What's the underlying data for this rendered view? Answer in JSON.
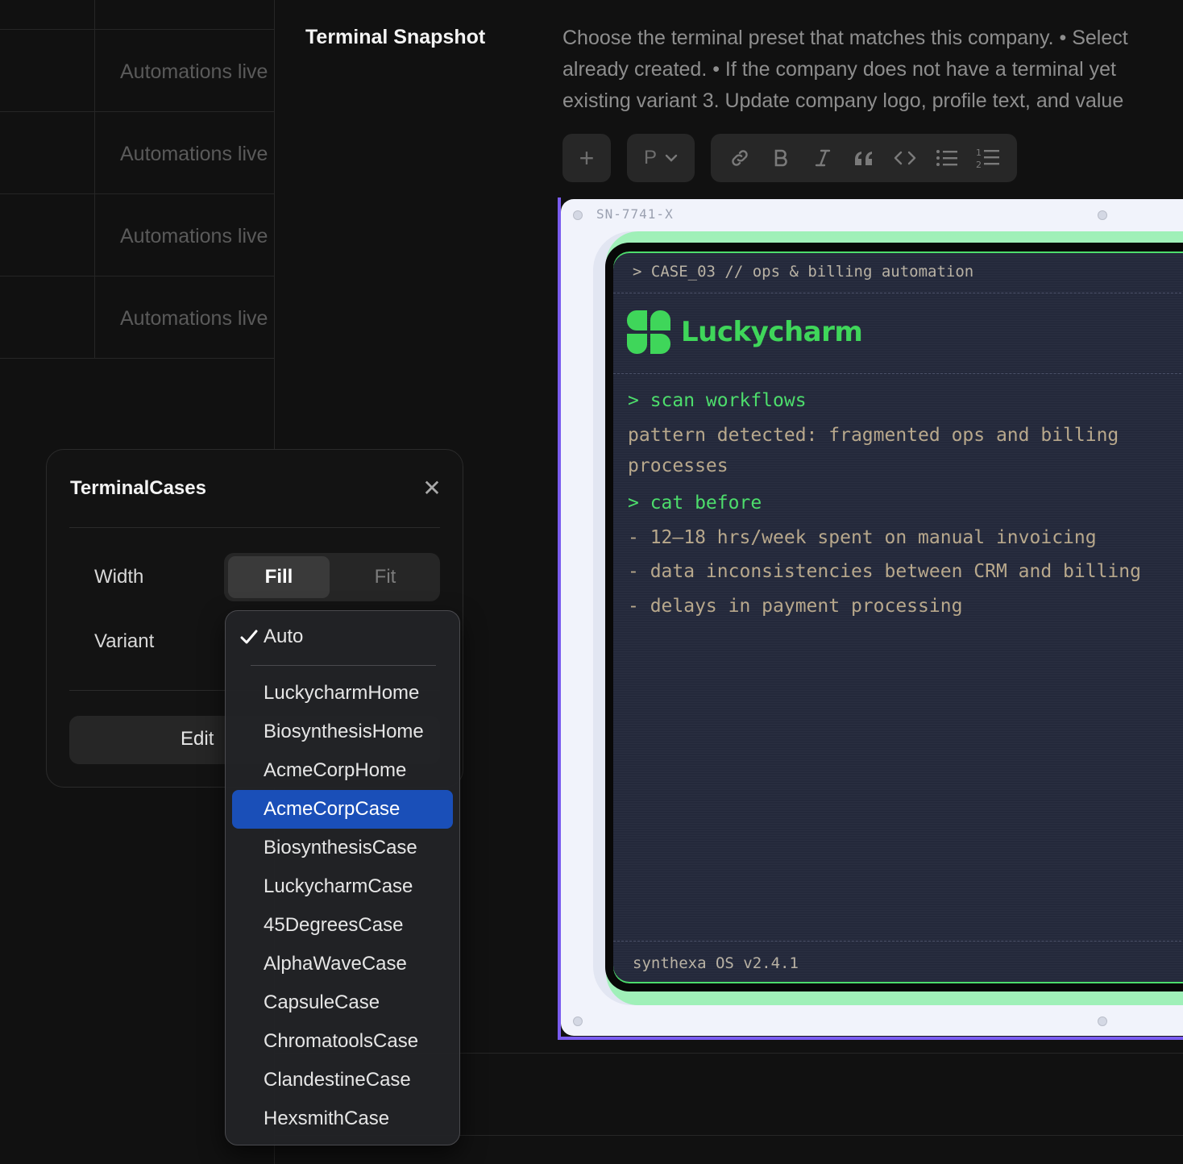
{
  "background_table": {
    "rows": [
      {
        "text": "Automations live"
      },
      {
        "text": "Automations live"
      },
      {
        "text": "Automations live"
      },
      {
        "text": "Automations live"
      }
    ]
  },
  "section": {
    "title": "Terminal Snapshot",
    "description_lines": [
      "Choose the terminal preset that matches this company. • Select",
      "already created. • If the company does not have a terminal yet",
      "existing variant 3. Update company logo, profile text, and value"
    ]
  },
  "toolbar": {
    "add_label": "+",
    "paragraph_label": "P",
    "format_icons": [
      "link-icon",
      "bold-icon",
      "italic-icon",
      "quote-icon",
      "code-icon",
      "bullet-list-icon",
      "numbered-list-icon"
    ]
  },
  "device": {
    "serial": "SN-7741-X",
    "header": "> CASE_03 // ops & billing automation",
    "brand": "Luckycharm",
    "lines": [
      {
        "kind": "cmd",
        "text": "> scan workflows"
      },
      {
        "kind": "out",
        "text": "pattern detected: fragmented ops and billing"
      },
      {
        "kind": "out",
        "text": "processes"
      },
      {
        "kind": "cmd",
        "text": "> cat before"
      },
      {
        "kind": "out",
        "text": "- 12–18 hrs/week spent on manual invoicing"
      },
      {
        "kind": "out",
        "text": "- data inconsistencies between CRM and billing"
      },
      {
        "kind": "out",
        "text": "- delays in payment processing"
      }
    ],
    "footer": "synthexa OS v2.4.1",
    "colors": {
      "accent": "#4ddd6c",
      "screen": "#24293b",
      "text": "#b8a88c",
      "selection": "#7a5cf0"
    }
  },
  "panel": {
    "title": "TerminalCases",
    "close_icon": "close-icon",
    "width_label": "Width",
    "width_options": [
      "Fill",
      "Fit"
    ],
    "width_selected": "Fill",
    "variant_label": "Variant",
    "edit_label": "Edit"
  },
  "dropdown": {
    "checked_item": "Auto",
    "selected_item": "AcmeCorpCase",
    "items": [
      "LuckycharmHome",
      "BiosynthesisHome",
      "AcmeCorpHome",
      "AcmeCorpCase",
      "BiosynthesisCase",
      "LuckycharmCase",
      "45DegreesCase",
      "AlphaWaveCase",
      "CapsuleCase",
      "ChromatoolsCase",
      "ClandestineCase",
      "HexsmithCase"
    ],
    "highlight_color": "#1a4fb8"
  }
}
